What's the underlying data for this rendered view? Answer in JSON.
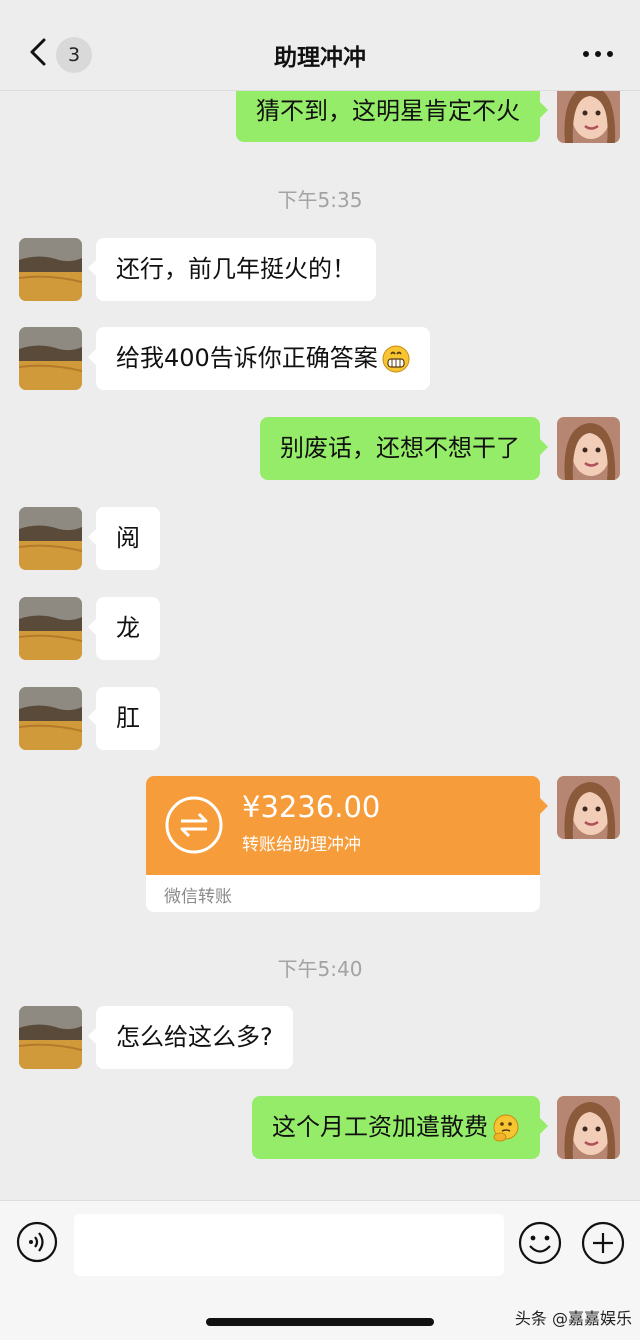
{
  "header": {
    "badge_count": "3",
    "title": "助理冲冲"
  },
  "messages": {
    "m0": "猜不到，这明星肯定不火",
    "t1": "下午5:35",
    "m1": "还行，前几年挺火的！",
    "m2": "给我400告诉你正确答案",
    "m3": "别废话，还想不想干了",
    "m4": "阅",
    "m5": "龙",
    "m6": "肛",
    "t2": "下午5:40",
    "m7": "怎么给这么多?",
    "m8": "这个月工资加遣散费"
  },
  "transfer": {
    "amount": "¥3236.00",
    "desc": "转账给助理冲冲",
    "footer": "微信转账",
    "color": "#f79c3a"
  },
  "icons": {
    "back": "chevron-left-icon",
    "more": "ellipsis-icon",
    "voice": "voice-icon",
    "emoji": "smiley-icon",
    "plus": "plus-icon",
    "transfer": "transfer-arrows-icon"
  },
  "colors": {
    "background": "#ededed",
    "sent_bubble": "#95ec69",
    "received_bubble": "#ffffff"
  },
  "watermark": "头条 @嘉嘉娱乐"
}
